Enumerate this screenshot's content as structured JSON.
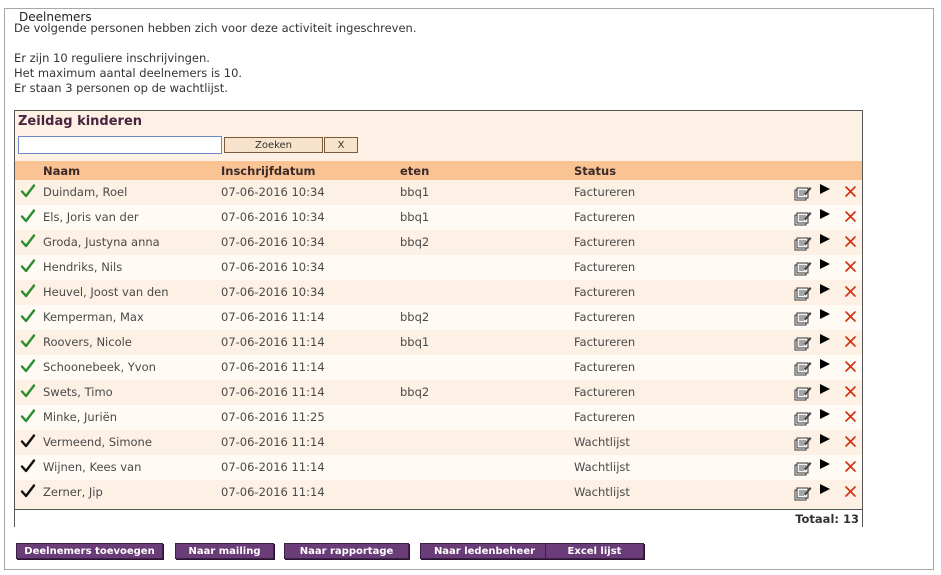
{
  "fieldset": {
    "legend": "Deelnemers",
    "intro_line1": "De volgende personen hebben zich voor deze activiteit ingeschreven.",
    "stat_regular": "Er zijn 10 reguliere inschrijvingen.",
    "stat_max": "Het maximum aantal deelnemers is 10.",
    "stat_waitlist": "Er staan 3 personen op de wachtlijst."
  },
  "panel": {
    "title": "Zeildag kinderen",
    "search": {
      "value": "",
      "placeholder": ""
    },
    "search_button": "Zoeken",
    "clear_button": "X",
    "columns": {
      "name": "Naam",
      "date": "Inschrijfdatum",
      "food": "eten",
      "status": "Status"
    },
    "rows": [
      {
        "name": "Duindam, Roel",
        "date": "07-06-2016 10:34",
        "food": "bbq1",
        "status": "Factureren",
        "check": "green"
      },
      {
        "name": "Els, Joris van der",
        "date": "07-06-2016 10:34",
        "food": "bbq1",
        "status": "Factureren",
        "check": "green"
      },
      {
        "name": "Groda, Justyna anna",
        "date": "07-06-2016 10:34",
        "food": "bbq2",
        "status": "Factureren",
        "check": "green"
      },
      {
        "name": "Hendriks, Nils",
        "date": "07-06-2016 10:34",
        "food": "",
        "status": "Factureren",
        "check": "green"
      },
      {
        "name": "Heuvel, Joost van den",
        "date": "07-06-2016 10:34",
        "food": "",
        "status": "Factureren",
        "check": "green"
      },
      {
        "name": "Kemperman, Max",
        "date": "07-06-2016 11:14",
        "food": "bbq2",
        "status": "Factureren",
        "check": "green"
      },
      {
        "name": "Roovers, Nicole",
        "date": "07-06-2016 11:14",
        "food": "bbq1",
        "status": "Factureren",
        "check": "green"
      },
      {
        "name": "Schoonebeek, Yvon",
        "date": "07-06-2016 11:14",
        "food": "",
        "status": "Factureren",
        "check": "green"
      },
      {
        "name": "Swets, Timo",
        "date": "07-06-2016 11:14",
        "food": "bbq2",
        "status": "Factureren",
        "check": "green"
      },
      {
        "name": "Minke, Juriën",
        "date": "07-06-2016 11:25",
        "food": "",
        "status": "Factureren",
        "check": "green"
      },
      {
        "name": "Vermeend, Simone",
        "date": "07-06-2016 11:14",
        "food": "",
        "status": "Wachtlijst",
        "check": "black"
      },
      {
        "name": "Wijnen, Kees van",
        "date": "07-06-2016 11:14",
        "food": "",
        "status": "Wachtlijst",
        "check": "black"
      },
      {
        "name": "Zerner, Jip",
        "date": "07-06-2016 11:14",
        "food": "",
        "status": "Wachtlijst",
        "check": "black"
      }
    ],
    "total_label": "Totaal: 13"
  },
  "actions": [
    {
      "label": "Deelnemers toevoegen",
      "name": "add-participants-button"
    },
    {
      "label": "Naar mailing",
      "name": "to-mailing-button"
    },
    {
      "label": "Naar rapportage",
      "name": "to-report-button"
    },
    {
      "label": "Naar ledenbeheer",
      "name": "to-member-management-button"
    },
    {
      "label": "Excel lijst",
      "name": "excel-list-button"
    }
  ],
  "colors": {
    "check_green": "#2e8b2e",
    "check_black": "#111111",
    "delete_red": "#d03010",
    "header_bg": "#f9c393",
    "button_purple": "#6b3d78"
  },
  "icons": {
    "row_check": "check-icon",
    "row_edit": "edit-icon",
    "row_details": "play-icon",
    "row_delete": "delete-icon"
  }
}
